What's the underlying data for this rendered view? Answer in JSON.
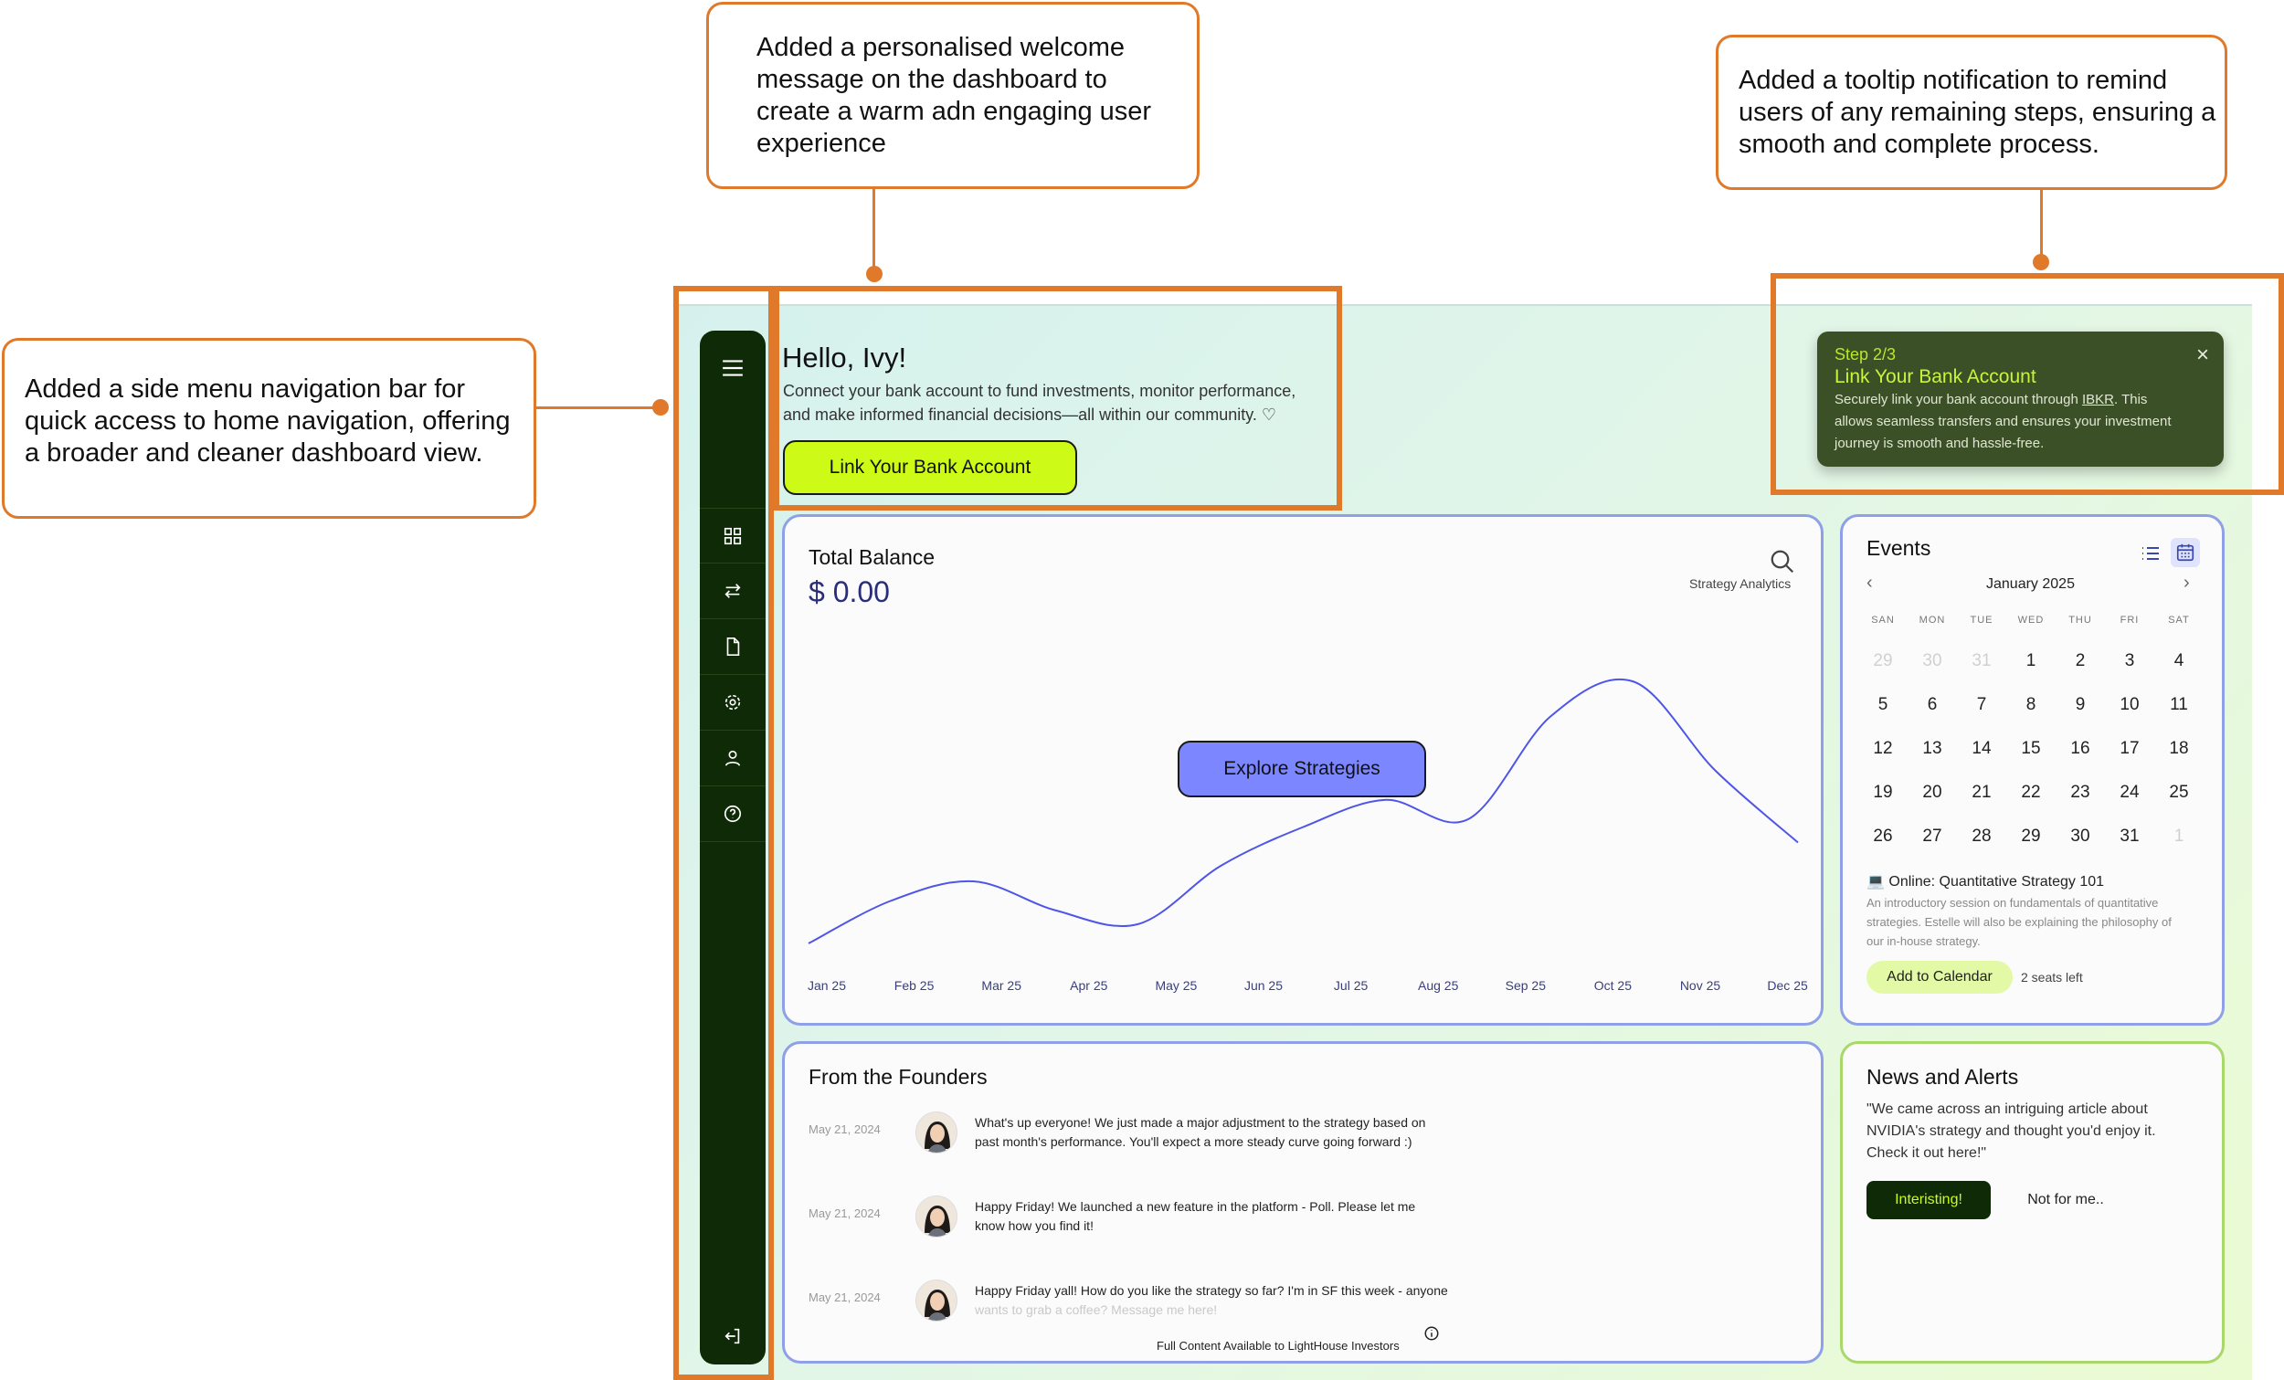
{
  "callouts": {
    "welcome": "Added a personalised welcome message on the dashboard to create a warm adn engaging user experience",
    "tooltip": "Added a tooltip notification to remind users of any remaining steps, ensuring a smooth and complete process.",
    "sidebar": "Added a side menu navigation bar for quick access to home navigation, offering a broader and cleaner dashboard view."
  },
  "colors": {
    "accent_orange": "#e07a2a",
    "lime": "#cdfa17",
    "sidebar": "#0f2a06",
    "chart_line": "#4e55e8",
    "explore_btn": "#7b86ff"
  },
  "sidebar": {
    "icons": [
      "menu-icon",
      "grid-icon",
      "transfer-icon",
      "document-icon",
      "settings-icon",
      "user-icon",
      "help-icon",
      "logout-icon"
    ]
  },
  "welcome": {
    "greeting": "Hello, Ivy!",
    "line1": "Connect your bank account to fund investments, monitor performance,",
    "line2": "and make informed financial decisions—all within our community. ♡",
    "cta": "Link Your Bank Account"
  },
  "tooltip": {
    "step": "Step 2/3",
    "title": "Link Your Bank Account",
    "line1_pre": "Securely link your bank account through ",
    "line1_link": "IBKR",
    "line1_post": ". This",
    "line2": "allows seamless transfers and ensures your investment",
    "line3": "journey is smooth and hassle-free.",
    "close": "×"
  },
  "balance": {
    "title": "Total Balance",
    "amount": "$ 0.00",
    "analytics_label": "Strategy Analytics",
    "explore_button": "Explore Strategies"
  },
  "chart_data": {
    "type": "line",
    "categories": [
      "Jan 25",
      "Feb 25",
      "Mar 25",
      "Apr 25",
      "May 25",
      "Jun 25",
      "Jul 25",
      "Aug 25",
      "Sep 25",
      "Oct 25",
      "Nov 25",
      "Dec 25"
    ],
    "series": [
      {
        "values": [
          8,
          30,
          40,
          25,
          18,
          48,
          68,
          82,
          72,
          125,
          143,
          97,
          60
        ]
      }
    ],
    "grid": false,
    "legend": "none"
  },
  "events": {
    "title": "Events",
    "month": "January 2025",
    "weekdays": [
      "SAN",
      "MON",
      "TUE",
      "WED",
      "THU",
      "FRI",
      "SAT"
    ],
    "weeks": [
      [
        "29",
        "30",
        "31",
        "1",
        "2",
        "3",
        "4"
      ],
      [
        "5",
        "6",
        "7",
        "8",
        "9",
        "10",
        "11"
      ],
      [
        "12",
        "13",
        "14",
        "15",
        "16",
        "17",
        "18"
      ],
      [
        "19",
        "20",
        "21",
        "22",
        "23",
        "24",
        "25"
      ],
      [
        "26",
        "27",
        "28",
        "29",
        "30",
        "31",
        "1"
      ]
    ],
    "event_title": "💻 Online: Quantitative Strategy 101",
    "event_desc1": "An introductory session on fundamentals of quantitative",
    "event_desc2": "strategies. Estelle will also be explaining the philosophy of",
    "event_desc3": "our in-house strategy.",
    "add_button": "Add to Calendar",
    "seats": "2 seats left"
  },
  "founders": {
    "title": "From the Founders",
    "posts": [
      {
        "date": "May 21, 2024",
        "line1": "What's up everyone! We just made a major adjustment to the strategy based on",
        "line2": "past month's performance. You'll expect a more steady curve going forward :)"
      },
      {
        "date": "May 21, 2024",
        "line1": "Happy Friday! We launched a new feature in the platform  -  Poll. Please let me",
        "line2": "know how you find it!"
      },
      {
        "date": "May 21, 2024",
        "line1": "Happy Friday yall! How do you like the strategy so far? I'm in SF this week - anyone",
        "line2": "wants to grab a coffee? Message me here!"
      }
    ],
    "footer": "Full Content Available to LightHouse Investors"
  },
  "news": {
    "title": "News and Alerts",
    "line1": "\"We came across an intriguing article about",
    "line2": "NVIDIA's strategy and thought you'd enjoy it.",
    "line3": "Check it out here!\"",
    "primary": "Interisting!",
    "secondary": "Not for me.."
  }
}
